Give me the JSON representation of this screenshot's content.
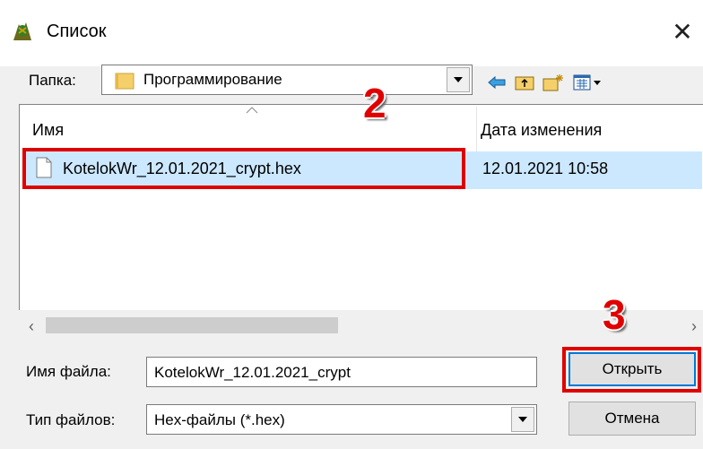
{
  "window": {
    "title": "Список"
  },
  "folder": {
    "label": "Папка:",
    "value": "Программирование"
  },
  "columns": {
    "name": "Имя",
    "date": "Дата изменения"
  },
  "files": [
    {
      "name": "KotelokWr_12.01.2021_crypt.hex",
      "date": "12.01.2021 10:58"
    }
  ],
  "filename": {
    "label": "Имя файла:",
    "value": "KotelokWr_12.01.2021_crypt"
  },
  "filetype": {
    "label": "Тип файлов:",
    "value": "Hex-файлы (*.hex)"
  },
  "buttons": {
    "open": "Открыть",
    "cancel": "Отмена"
  },
  "annotations": {
    "step2": "2",
    "step3": "3"
  },
  "colors": {
    "selection": "#cce8ff",
    "highlight": "#e00000",
    "accent": "#0078d7"
  },
  "icons": [
    "app-icon",
    "folder-icon",
    "back-arrow-icon",
    "up-folder-icon",
    "new-folder-icon",
    "view-menu-icon",
    "file-icon",
    "close-icon"
  ]
}
